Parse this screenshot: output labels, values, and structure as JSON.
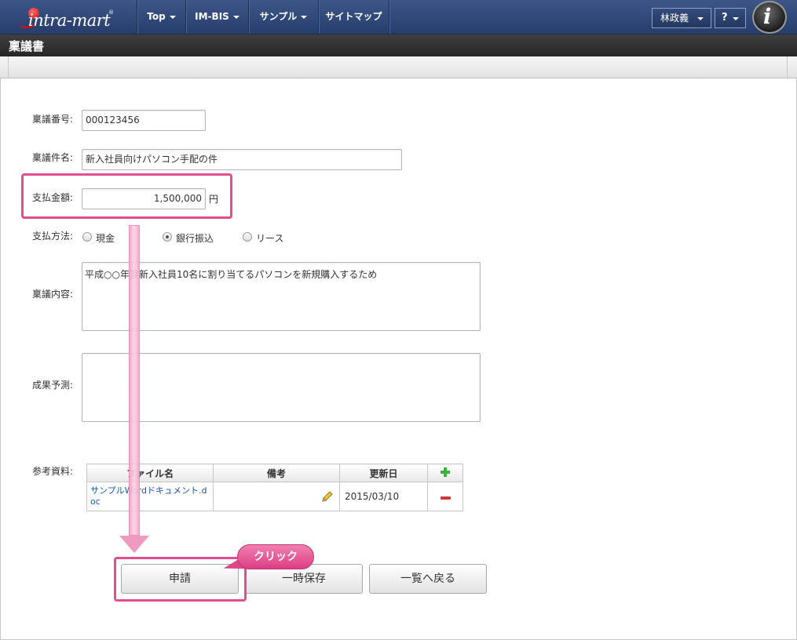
{
  "header": {
    "logo_text": "intra-mart",
    "nav": [
      "Top",
      "IM-BIS",
      "サンプル",
      "サイトマップ"
    ],
    "user_name": "林政義",
    "help_label": "?",
    "avatar_letter": "i"
  },
  "page": {
    "title": "稟議書"
  },
  "form": {
    "number_label": "稟議番号:",
    "number_value": "000123456",
    "subject_label": "稟議件名:",
    "subject_value": "新入社員向けパソコン手配の件",
    "amount_label": "支払金額:",
    "amount_value": "1,500,000",
    "amount_unit": "円",
    "method_label": "支払方法:",
    "methods": [
      "現金",
      "銀行振込",
      "リース"
    ],
    "method_selected": "銀行振込",
    "content_label": "稟議内容:",
    "content_value": "平成○○年度新入社員10名に割り当てるパソコンを新規購入するため",
    "outcome_label": "成果予測:",
    "outcome_value": "",
    "attachments_label": "参考資料:"
  },
  "attachments": {
    "columns": [
      "ファイル名",
      "備考",
      "更新日"
    ],
    "rows": [
      {
        "file": "サンプルWordドキュメント.doc",
        "note": "",
        "updated": "2015/03/10"
      }
    ]
  },
  "buttons": {
    "apply": "申請",
    "save_draft": "一時保存",
    "back_to_list": "一覧へ戻る"
  },
  "annotation": {
    "callout": "クリック"
  },
  "colors": {
    "highlight": "#e44d8f",
    "nav_bg": "#2f4677",
    "add": "#3db23d",
    "remove": "#d23a3a"
  }
}
